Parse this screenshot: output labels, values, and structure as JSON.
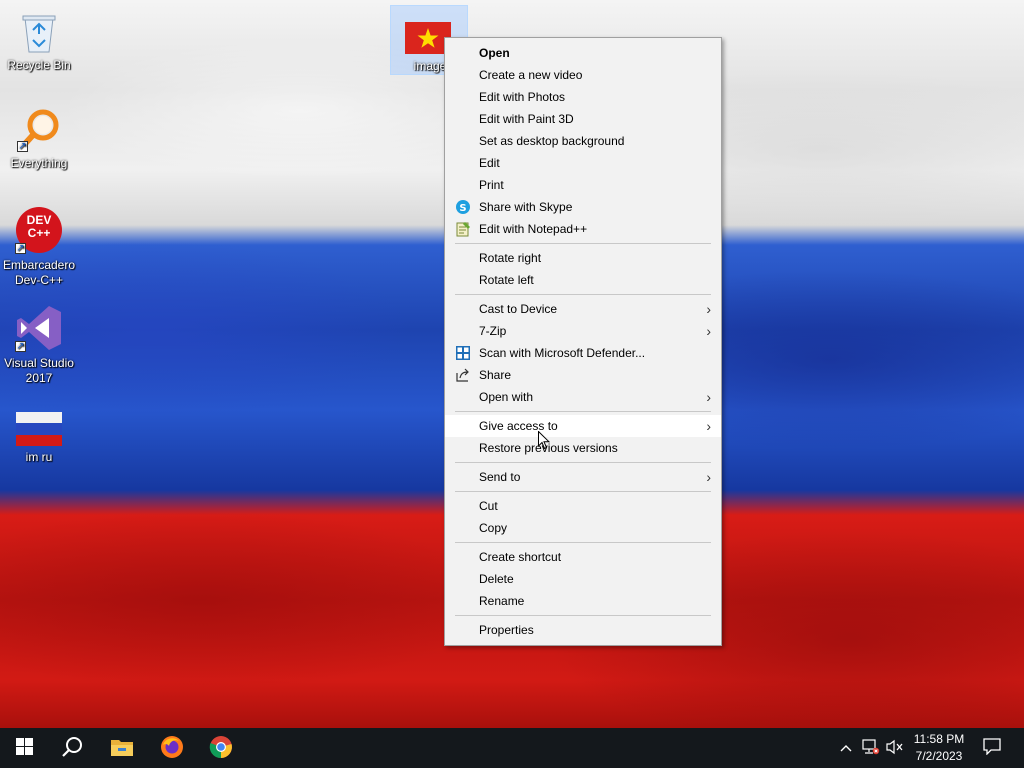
{
  "desktop": {
    "icons": [
      {
        "label": "Recycle Bin"
      },
      {
        "label": "Everything"
      },
      {
        "label": "Embarcadero Dev-C++",
        "glyph_text": "DEV C++"
      },
      {
        "label": "Visual Studio 2017"
      },
      {
        "label": "im ru"
      }
    ],
    "selected_file": {
      "label": "image"
    }
  },
  "context_menu": {
    "items": [
      {
        "label": "Open"
      },
      {
        "label": "Create a new video"
      },
      {
        "label": "Edit with Photos"
      },
      {
        "label": "Edit with Paint 3D"
      },
      {
        "label": "Set as desktop background"
      },
      {
        "label": "Edit"
      },
      {
        "label": "Print"
      },
      {
        "label": "Share with Skype"
      },
      {
        "label": "Edit with Notepad++"
      },
      {
        "label": "Rotate right"
      },
      {
        "label": "Rotate left"
      },
      {
        "label": "Cast to Device"
      },
      {
        "label": "7-Zip"
      },
      {
        "label": "Scan with Microsoft Defender..."
      },
      {
        "label": "Share"
      },
      {
        "label": "Open with"
      },
      {
        "label": "Give access to"
      },
      {
        "label": "Restore previous versions"
      },
      {
        "label": "Send to"
      },
      {
        "label": "Cut"
      },
      {
        "label": "Copy"
      },
      {
        "label": "Create shortcut"
      },
      {
        "label": "Delete"
      },
      {
        "label": "Rename"
      },
      {
        "label": "Properties"
      }
    ],
    "hovered_item": "Give access to"
  },
  "taskbar": {
    "pinned_apps": [
      "start-icon",
      "search-icon",
      "file-explorer-icon",
      "firefox-icon",
      "chrome-icon"
    ],
    "clock": {
      "time": "11:58 PM",
      "date": "7/2/2023"
    },
    "tray_icons": [
      "chevron-up-icon",
      "network-icon",
      "volume-muted-icon",
      "notification-icon"
    ]
  },
  "colors": {
    "menu_bg": "#f2f2f2",
    "menu_hover": "#ffffff",
    "taskbar_bg": "#14181c",
    "flag_white": "#f0f0f0",
    "flag_blue": "#1e44b0",
    "flag_red": "#d21a14"
  }
}
